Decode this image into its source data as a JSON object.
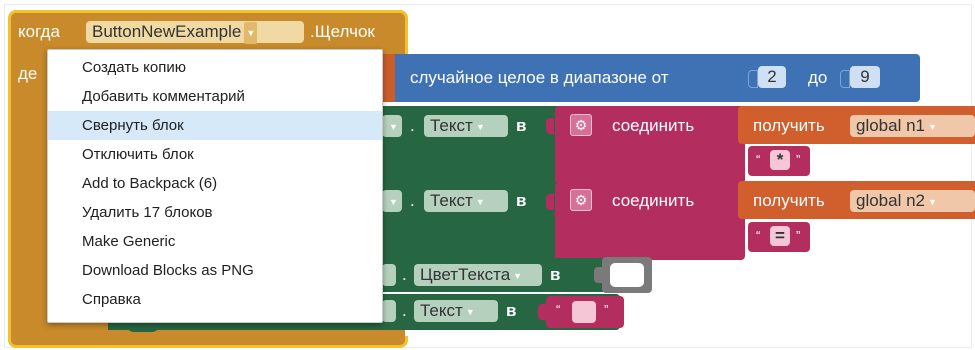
{
  "colors": {
    "event_block": "#c88a2a",
    "event_border": "#f2c12e",
    "math_block": "#3f71b5",
    "setter_block": "#266643",
    "text_block": "#b32d5e",
    "getter_block": "#d05f2d",
    "gray_block": "#7a7a7a",
    "menu_highlight": "#d6e9f8"
  },
  "event": {
    "prefix": "когда",
    "component": "ButtonNewExample",
    "event_name": ".Щелчок",
    "do_label": "де"
  },
  "random_block": {
    "label": "случайное целое в диапазоне от",
    "from": "2",
    "to_label": "до",
    "to": "9"
  },
  "rows": [
    {
      "property": "Текст",
      "to_label": "в",
      "join_label": "соединить",
      "getter_label": "получить",
      "variable": "global n1",
      "string": "*"
    },
    {
      "property": "Текст",
      "to_label": "в",
      "join_label": "соединить",
      "getter_label": "получить",
      "variable": "global n2",
      "string": "="
    }
  ],
  "color_row": {
    "property": "ЦветТекста",
    "to_label": "в"
  },
  "text_row": {
    "property": "Текст",
    "to_label": "в",
    "string": ""
  },
  "menu": {
    "items": [
      "Создать копию",
      "Добавить комментарий",
      "Свернуть блок",
      "Отключить блок",
      "Add to Backpack (6)",
      "Удалить 17 блоков",
      "Make Generic",
      "Download Blocks as PNG",
      "Справка"
    ],
    "highlighted_index": 2
  },
  "icons": {
    "dropdown": "triangle-down",
    "join_mutator": "gear-icon"
  }
}
